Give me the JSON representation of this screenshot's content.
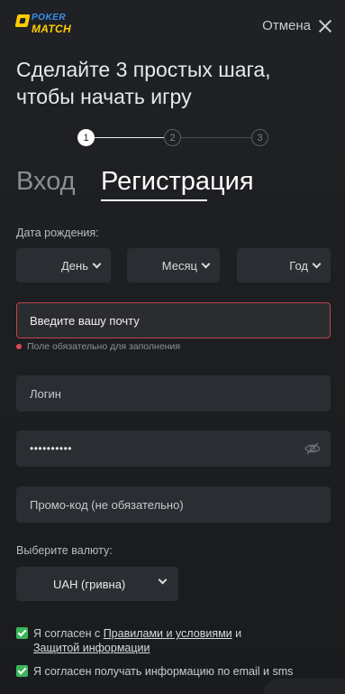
{
  "header": {
    "logo_line1": "POKER",
    "logo_line2": "MATCH",
    "cancel_label": "Отмена"
  },
  "headline": "Сделайте 3 простых шага, чтобы начать игру",
  "steps": [
    "1",
    "2",
    "3"
  ],
  "tabs": {
    "login": "Вход",
    "register": "Регистрация"
  },
  "birthdate": {
    "label": "Дата рождения:",
    "day": "День",
    "month": "Месяц",
    "year": "Год"
  },
  "email": {
    "placeholder": "Введите вашу почту",
    "error": "Поле обязательно для заполнения"
  },
  "login_field": {
    "placeholder": "Логин"
  },
  "password_field": {
    "value": "••••••••••"
  },
  "promo_field": {
    "placeholder": "Промо-код (не обязательно)"
  },
  "currency": {
    "label": "Выберите валюту:",
    "selected": "UAH (гривна)"
  },
  "consents": {
    "terms_prefix": "Я согласен с ",
    "terms_link": "Правилами и условиями",
    "terms_and": " и",
    "privacy_link": "Защитой информации",
    "marketing": "Я согласен получать информацию по email и sms"
  },
  "colors": {
    "accent_yellow": "#ffcc00",
    "accent_blue": "#3b8ff0",
    "error_red": "#c2424b",
    "check_green": "#3cb55a"
  }
}
